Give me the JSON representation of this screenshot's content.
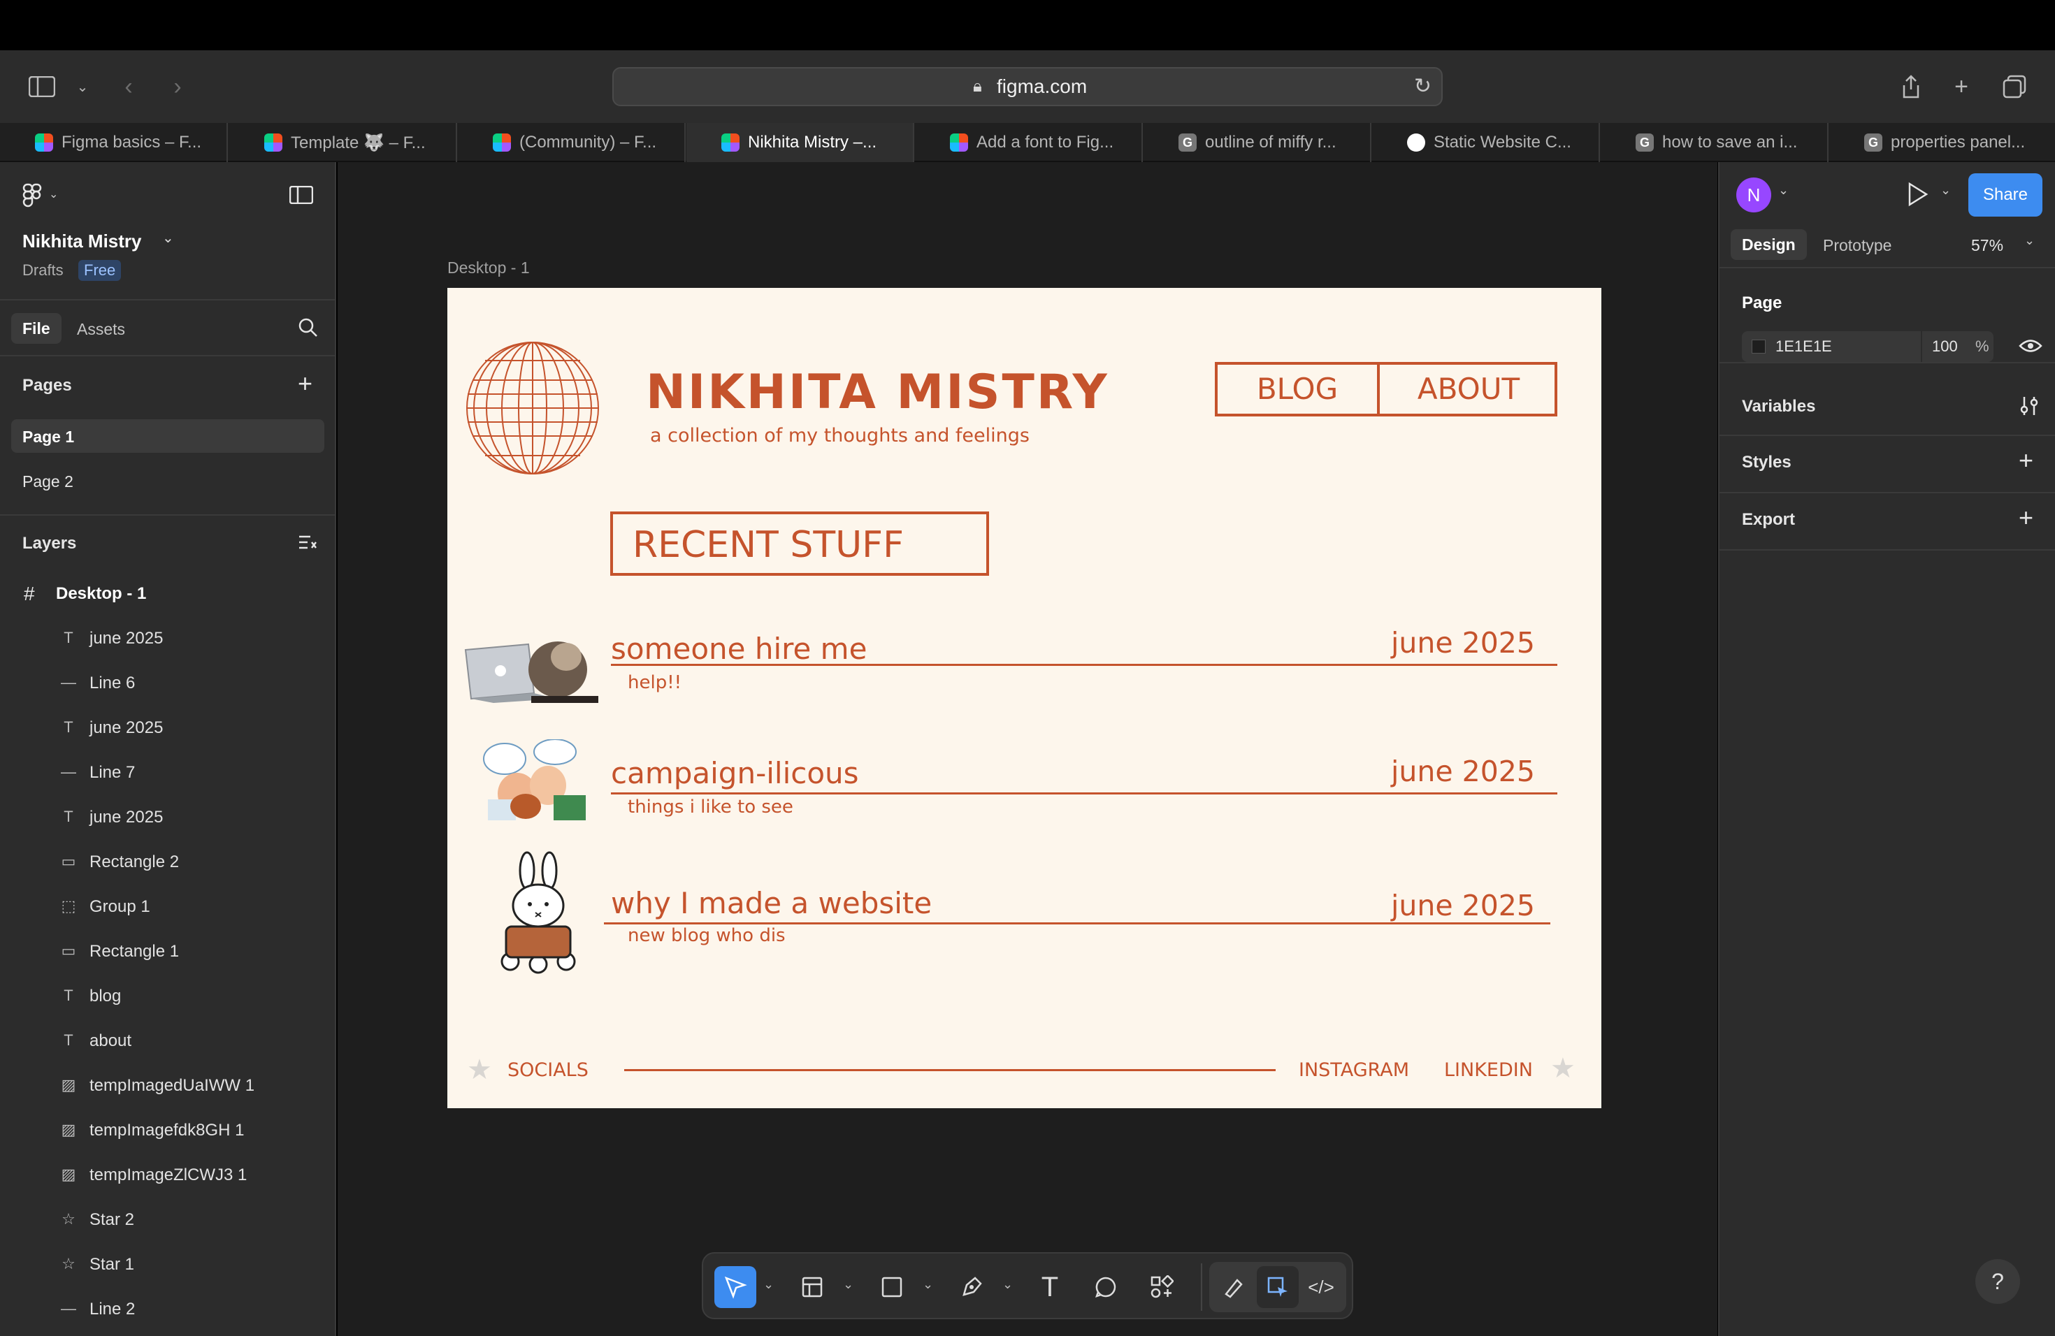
{
  "browser": {
    "url": "figma.com",
    "tabs": [
      {
        "label": "Figma basics – F...",
        "icon": "figma-icon"
      },
      {
        "label": "Template 🐺 – F...",
        "icon": "figma-icon"
      },
      {
        "label": "(Community) – F...",
        "icon": "figma-icon"
      },
      {
        "label": "Nikhita Mistry –...",
        "icon": "figma-icon",
        "active": true
      },
      {
        "label": "Add a font to Fig...",
        "icon": "figma-icon"
      },
      {
        "label": "outline of miffy r...",
        "icon": "g-icon"
      },
      {
        "label": "Static Website C...",
        "icon": "chatgpt-icon"
      },
      {
        "label": "how to save an i...",
        "icon": "g-icon"
      },
      {
        "label": "properties panel...",
        "icon": "g-icon"
      }
    ]
  },
  "left_panel": {
    "file_name": "Nikhita Mistry",
    "drafts": "Drafts",
    "plan_badge": "Free",
    "tab_file": "File",
    "tab_assets": "Assets",
    "pages_title": "Pages",
    "pages": [
      "Page 1",
      "Page 2"
    ],
    "layers_title": "Layers",
    "frame_layer": "Desktop - 1",
    "layers": [
      {
        "name": "june 2025",
        "icon": "text-icon"
      },
      {
        "name": "Line 6",
        "icon": "line-icon"
      },
      {
        "name": "june 2025",
        "icon": "text-icon"
      },
      {
        "name": "Line 7",
        "icon": "line-icon"
      },
      {
        "name": "june 2025",
        "icon": "text-icon"
      },
      {
        "name": "Rectangle 2",
        "icon": "rectangle-icon"
      },
      {
        "name": "Group 1",
        "icon": "group-icon"
      },
      {
        "name": "Rectangle 1",
        "icon": "rectangle-icon"
      },
      {
        "name": "blog",
        "icon": "text-icon"
      },
      {
        "name": "about",
        "icon": "text-icon"
      },
      {
        "name": "tempImagedUaIWW 1",
        "icon": "image-icon"
      },
      {
        "name": "tempImagefdk8GH 1",
        "icon": "image-icon"
      },
      {
        "name": "tempImageZlCWJ3 1",
        "icon": "image-icon"
      },
      {
        "name": "Star 2",
        "icon": "star-icon"
      },
      {
        "name": "Star 1",
        "icon": "star-icon"
      },
      {
        "name": "Line 2",
        "icon": "line-icon"
      }
    ]
  },
  "canvas": {
    "frame_label": "Desktop - 1",
    "site": {
      "title": "NIKHITA MISTRY",
      "subtitle": "a collection of my thoughts and feelings",
      "nav_blog": "BLOG",
      "nav_about": "ABOUT",
      "section_title": "RECENT STUFF",
      "posts": [
        {
          "title": "someone hire me",
          "date": "june 2025",
          "desc": "help!!"
        },
        {
          "title": "campaign-ilicous",
          "date": "june 2025",
          "desc": "things i like to see"
        },
        {
          "title": "why I made a website",
          "date": "june 2025",
          "desc": "new blog who dis"
        }
      ],
      "footer_socials": "SOCIALS",
      "footer_instagram": "INSTAGRAM",
      "footer_linkedin": "LINKEDIN",
      "accent_color": "#c5532c",
      "background_color": "#fdf6ec"
    }
  },
  "right_panel": {
    "avatar_initial": "N",
    "share": "Share",
    "tab_design": "Design",
    "tab_prototype": "Prototype",
    "zoom": "57%",
    "page_title": "Page",
    "page_color": "1E1E1E",
    "page_opacity": "100",
    "percent": "%",
    "variables": "Variables",
    "styles": "Styles",
    "export": "Export"
  },
  "help": "?"
}
